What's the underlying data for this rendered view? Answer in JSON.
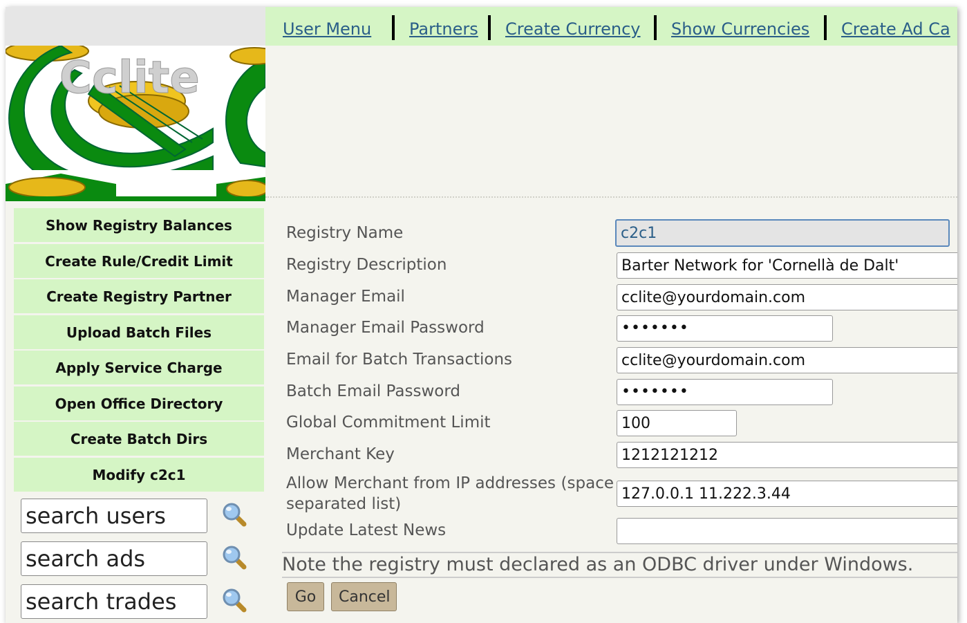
{
  "nav": {
    "links": [
      "User Menu",
      "Partners",
      "Create Currency",
      "Show Currencies",
      "Create Ad Ca"
    ]
  },
  "logo": {
    "text": "Cclite"
  },
  "sidebar": {
    "items": [
      "Show Registry Balances",
      "Create Rule/Credit Limit",
      "Create Registry Partner",
      "Upload Batch Files",
      "Apply Service Charge",
      "Open Office Directory",
      "Create Batch Dirs",
      "Modify c2c1"
    ],
    "search": [
      {
        "placeholder": "search users",
        "icon": "magnifier-icon"
      },
      {
        "placeholder": "search ads",
        "icon": "magnifier-icon"
      },
      {
        "placeholder": "search trades",
        "icon": "magnifier-icon"
      }
    ]
  },
  "form": {
    "registry_name": {
      "label": "Registry Name",
      "value": "c2c1"
    },
    "registry_description": {
      "label": "Registry Description",
      "value": "Barter Network for 'Cornellà de Dalt'"
    },
    "manager_email": {
      "label": "Manager Email",
      "value": "cclite@yourdomain.com"
    },
    "manager_email_password": {
      "label": "Manager Email Password",
      "value": "•••••••"
    },
    "batch_email": {
      "label": "Email for Batch Transactions",
      "value": "cclite@yourdomain.com"
    },
    "batch_email_password": {
      "label": "Batch Email Password",
      "value": "•••••••"
    },
    "global_limit": {
      "label": "Global Commitment Limit",
      "value": "100"
    },
    "merchant_key": {
      "label": "Merchant Key",
      "value": "1212121212"
    },
    "allow_merchant_ip": {
      "label": "Allow Merchant from IP addresses (space separated list)",
      "value": "127.0.0.1 11.222.3.44"
    },
    "latest_news": {
      "label": "Update Latest News",
      "value": ""
    },
    "note": "Note the registry must declared as an ODBC driver under Windows.",
    "go_label": "Go",
    "cancel_label": "Cancel"
  },
  "colors": {
    "menu_bg": "#d5f5c5",
    "page_bg": "#f4f4ee",
    "link": "#2a5e88",
    "button": "#c8b89a"
  }
}
